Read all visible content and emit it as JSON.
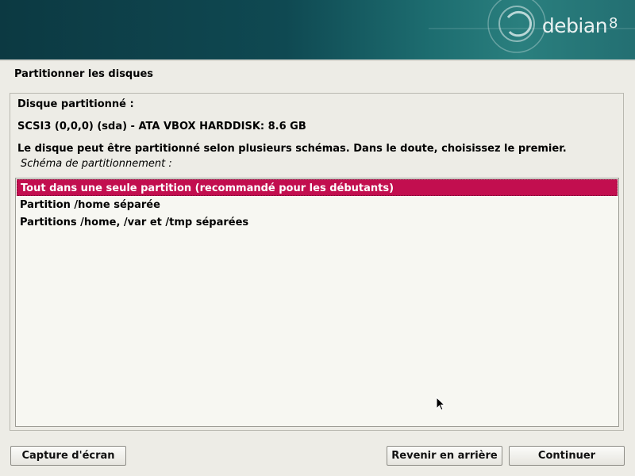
{
  "header": {
    "brand": "debian",
    "version": "8"
  },
  "page": {
    "title": "Partitionner les disques"
  },
  "content": {
    "disk_label": "Disque partitionné :",
    "disk_name": "SCSI3 (0,0,0) (sda) - ATA VBOX HARDDISK: 8.6 GB",
    "description": "Le disque peut être partitionné selon plusieurs schémas. Dans le doute, choisissez le premier.",
    "scheme_label": "Schéma de partitionnement :",
    "options": [
      {
        "label": "Tout dans une seule partition (recommandé pour les débutants)",
        "selected": true
      },
      {
        "label": "Partition /home séparée",
        "selected": false
      },
      {
        "label": "Partitions /home, /var et /tmp séparées",
        "selected": false
      }
    ]
  },
  "buttons": {
    "screenshot": "Capture d'écran",
    "back": "Revenir en arrière",
    "continue": "Continuer"
  },
  "colors": {
    "selection": "#c20e4f",
    "banner": "#0f4952",
    "background": "#edece6"
  },
  "icons": {
    "logo": "debian-swirl-icon",
    "pointer": "mouse-pointer-icon"
  }
}
